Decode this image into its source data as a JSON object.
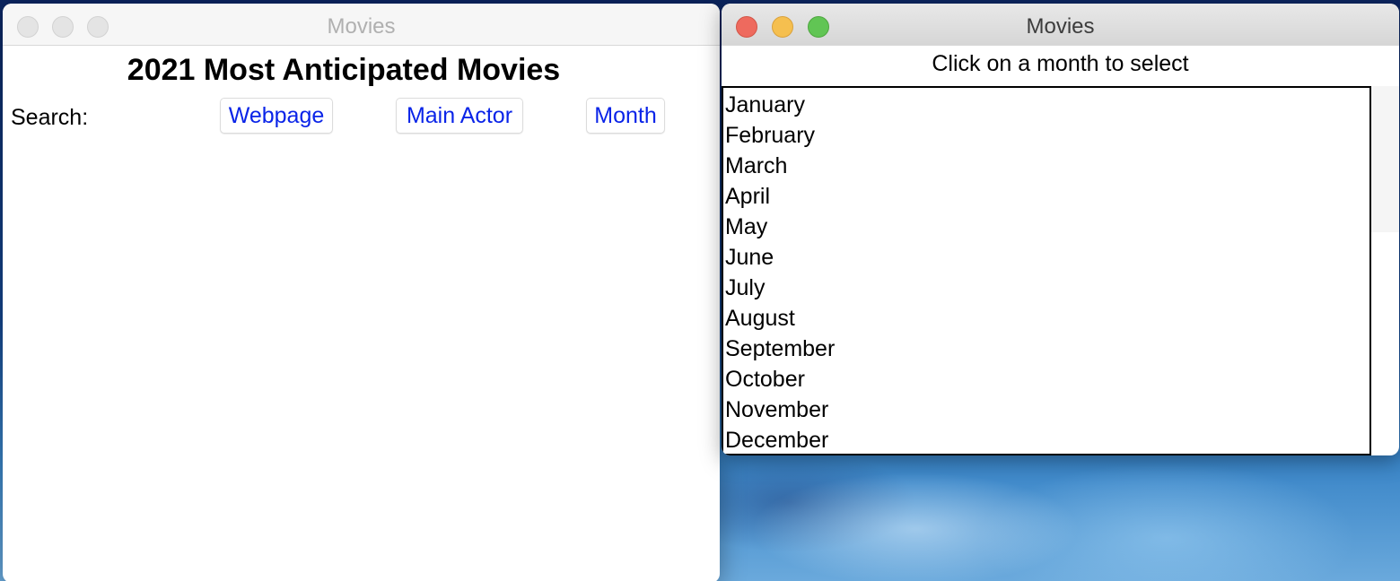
{
  "left_window": {
    "title": "Movies",
    "active": false,
    "heading": "2021 Most Anticipated Movies",
    "search_label": "Search:",
    "buttons": {
      "webpage": "Webpage",
      "main_actor": "Main Actor",
      "month": "Month"
    }
  },
  "right_window": {
    "title": "Movies",
    "active": true,
    "instruction": "Click on a month to select",
    "months": [
      "January",
      "February",
      "March",
      "April",
      "May",
      "June",
      "July",
      "August",
      "September",
      "October",
      "November",
      "December"
    ]
  },
  "colors": {
    "link_text": "#0a24e8",
    "close": "#ee6a5e",
    "minimize": "#f5bf4f",
    "zoom": "#61c554"
  }
}
